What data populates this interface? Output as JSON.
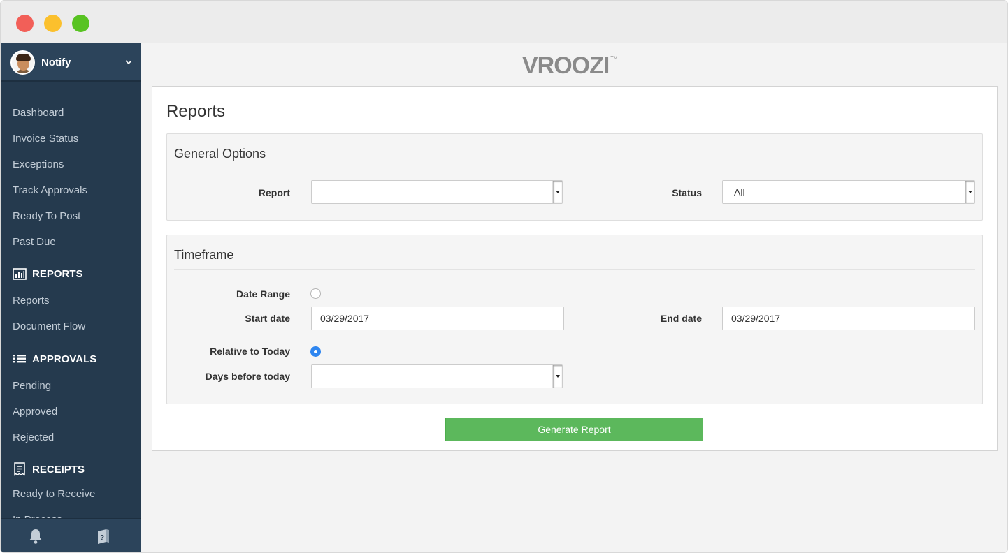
{
  "sidebar": {
    "user_name": "Notify",
    "items_top": [
      "Dashboard",
      "Invoice Status",
      "Exceptions",
      "Track Approvals",
      "Ready To Post",
      "Past Due"
    ],
    "reports_heading": "REPORTS",
    "reports_items": [
      "Reports",
      "Document Flow"
    ],
    "approvals_heading": "APPROVALS",
    "approvals_items": [
      "Pending",
      "Approved",
      "Rejected"
    ],
    "receipts_heading": "RECEIPTS",
    "receipts_items": [
      "Ready to Receive",
      "In Process"
    ]
  },
  "logo": {
    "text": "VROOZI",
    "tm": "TM"
  },
  "page": {
    "title": "Reports",
    "general": {
      "title": "General Options",
      "report_label": "Report",
      "report_value": "",
      "status_label": "Status",
      "status_value": "All"
    },
    "timeframe": {
      "title": "Timeframe",
      "date_range_label": "Date Range",
      "date_range_selected": false,
      "start_label": "Start date",
      "start_value": "03/29/2017",
      "end_label": "End date",
      "end_value": "03/29/2017",
      "relative_label": "Relative to Today",
      "relative_selected": true,
      "days_label": "Days before today",
      "days_value": ""
    },
    "generate_label": "Generate Report"
  },
  "icons": {
    "user_menu": "chevron-down-icon",
    "reports": "bar-chart-icon",
    "approvals": "list-icon",
    "receipts": "receipt-icon",
    "footer_left": "bell-icon",
    "footer_right": "help-book-icon"
  },
  "colors": {
    "sidebar": "#253a4e",
    "accent_green": "#5cb85c",
    "radio_blue": "#2f86f0"
  }
}
